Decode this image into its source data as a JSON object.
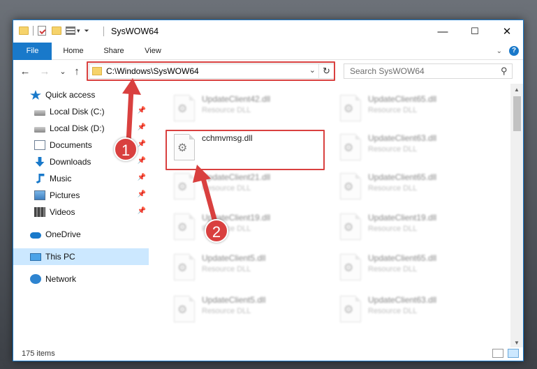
{
  "window": {
    "title": "SysWOW64",
    "controls": {
      "minimize": "—",
      "maximize": "☐",
      "close": "✕"
    }
  },
  "ribbon": {
    "tabs": [
      {
        "label": "File",
        "active": true
      },
      {
        "label": "Home"
      },
      {
        "label": "Share"
      },
      {
        "label": "View"
      }
    ],
    "expand_icon": "chevron-down-icon",
    "help_label": "?"
  },
  "navigation": {
    "back": "←",
    "forward": "→",
    "recent": "⌄",
    "up": "↑",
    "address": "C:\\Windows\\SysWOW64",
    "search_placeholder": "Search SysWOW64"
  },
  "sidebar": {
    "items": [
      {
        "label": "Quick access",
        "icon": "star-icon",
        "pinned": false
      },
      {
        "label": "Local Disk (C:)",
        "icon": "drive-icon",
        "pinned": true
      },
      {
        "label": "Local Disk (D:)",
        "icon": "drive-icon",
        "pinned": true
      },
      {
        "label": "Documents",
        "icon": "documents-icon",
        "pinned": true
      },
      {
        "label": "Downloads",
        "icon": "downloads-icon",
        "pinned": true
      },
      {
        "label": "Music",
        "icon": "music-icon",
        "pinned": true
      },
      {
        "label": "Pictures",
        "icon": "pictures-icon",
        "pinned": true
      },
      {
        "label": "Videos",
        "icon": "videos-icon",
        "pinned": true
      },
      {
        "label": "OneDrive",
        "icon": "cloud-icon",
        "pinned": false
      },
      {
        "label": "This PC",
        "icon": "computer-icon",
        "pinned": false,
        "selected": true
      },
      {
        "label": "Network",
        "icon": "network-icon",
        "pinned": false
      }
    ],
    "pin_glyph": "📌"
  },
  "files": {
    "left_column": [
      {
        "name": "UpdateClient42.dll",
        "type": "Resource DLL"
      },
      {
        "name": "cchmvmsg.dll",
        "type": "",
        "highlighted": true
      },
      {
        "name": "UpdateClient21.dll",
        "type": "Resource DLL"
      },
      {
        "name": "UpdateClient19.dll",
        "type": "Resource DLL"
      },
      {
        "name": "UpdateClient5.dll",
        "type": "Resource DLL"
      },
      {
        "name": "UpdateClient5.dll",
        "type": "Resource DLL"
      }
    ],
    "right_column": [
      {
        "name": "UpdateClient65.dll",
        "type": "Resource DLL"
      },
      {
        "name": "UpdateClient63.dll",
        "type": "Resource DLL"
      },
      {
        "name": "UpdateClient65.dll",
        "type": "Resource DLL"
      },
      {
        "name": "UpdateClient19.dll",
        "type": "Resource DLL"
      },
      {
        "name": "UpdateClient65.dll",
        "type": "Resource DLL"
      },
      {
        "name": "UpdateClient63.dll",
        "type": "Resource DLL"
      }
    ]
  },
  "status": {
    "item_count": "175 items"
  },
  "callouts": [
    "1",
    "2"
  ],
  "colors": {
    "accent": "#1979ca",
    "highlight": "#d9403f",
    "selected": "#cce8ff"
  }
}
